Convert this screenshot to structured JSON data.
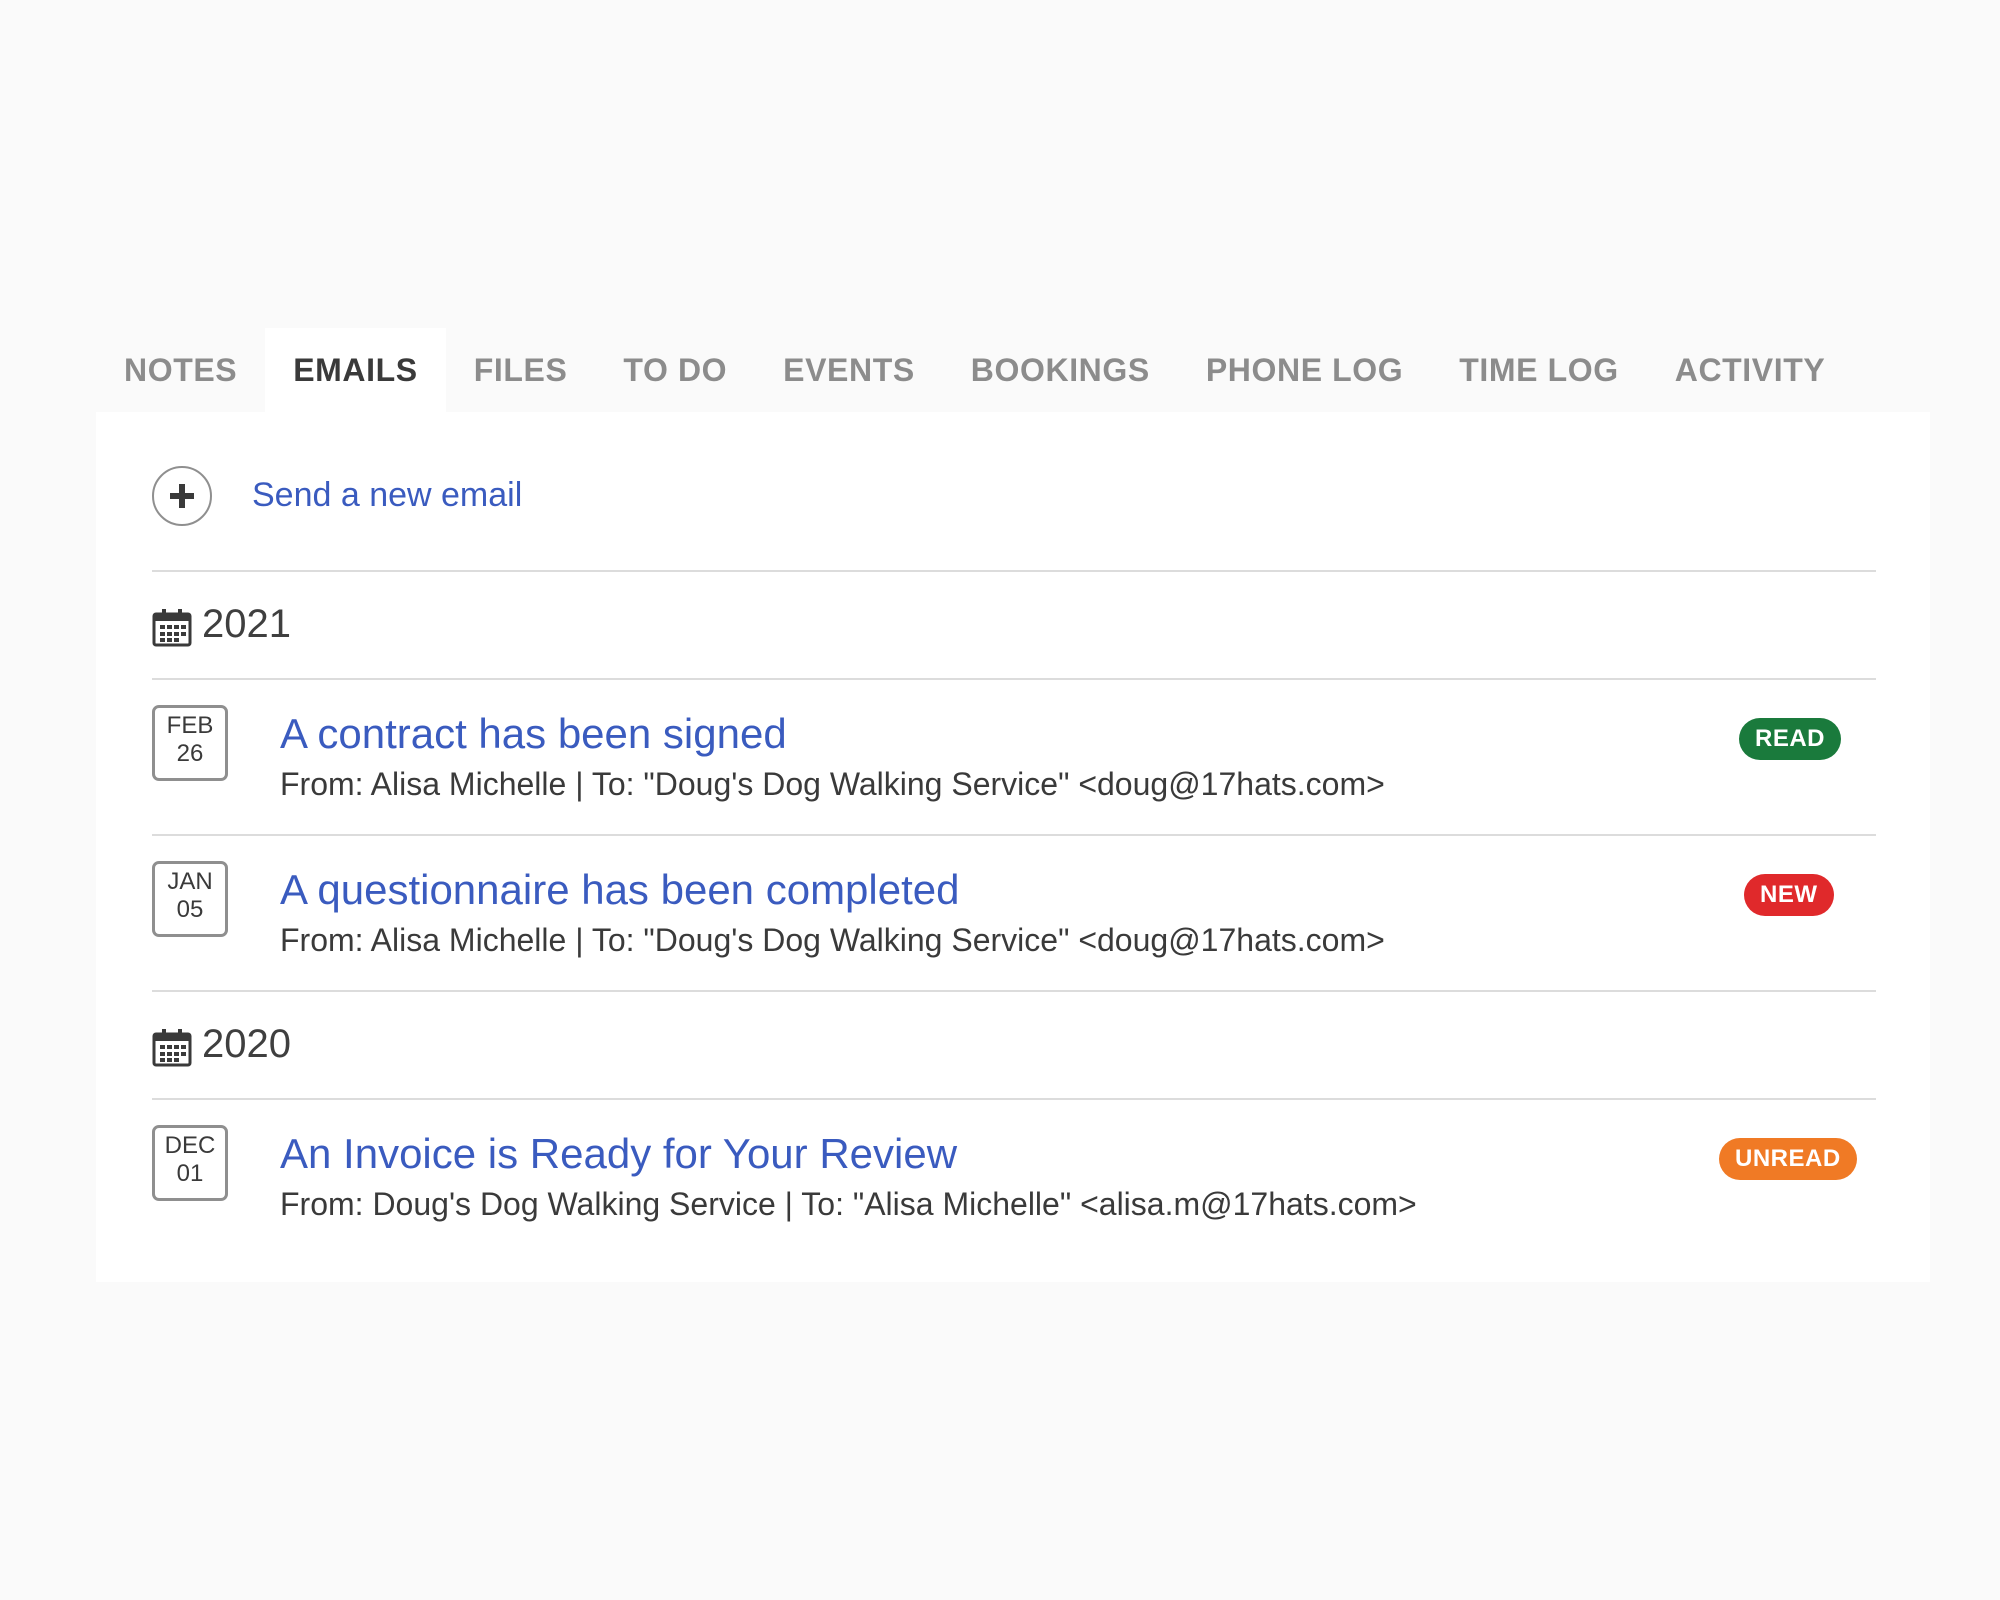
{
  "tabs": [
    {
      "label": "NOTES",
      "active": false
    },
    {
      "label": "EMAILS",
      "active": true
    },
    {
      "label": "FILES",
      "active": false
    },
    {
      "label": "TO DO",
      "active": false
    },
    {
      "label": "EVENTS",
      "active": false
    },
    {
      "label": "BOOKINGS",
      "active": false
    },
    {
      "label": "PHONE LOG",
      "active": false
    },
    {
      "label": "TIME LOG",
      "active": false
    },
    {
      "label": "ACTIVITY",
      "active": false
    }
  ],
  "send": {
    "label": "Send a new email",
    "icon": "plus-icon"
  },
  "groups": [
    {
      "year": "2021",
      "icon": "calendar-icon",
      "emails": [
        {
          "month": "FEB",
          "day": "26",
          "subject": "A contract has been signed",
          "meta": "From: Alisa Michelle | To: \"Doug's Dog Walking Service\" <doug@17hats.com>",
          "status": "READ",
          "status_color": "#1a7a3c"
        },
        {
          "month": "JAN",
          "day": "05",
          "subject": "A questionnaire has been completed",
          "meta": "From: Alisa Michelle | To: \"Doug's Dog Walking Service\" <doug@17hats.com>",
          "status": "NEW",
          "status_color": "#e0292b"
        }
      ]
    },
    {
      "year": "2020",
      "icon": "calendar-icon",
      "emails": [
        {
          "month": "DEC",
          "day": "01",
          "subject": "An Invoice is Ready for Your Review",
          "meta": "From: Doug's Dog Walking Service | To: \"Alisa Michelle\" <alisa.m@17hats.com>",
          "status": "UNREAD",
          "status_color": "#f07a25"
        }
      ]
    }
  ]
}
